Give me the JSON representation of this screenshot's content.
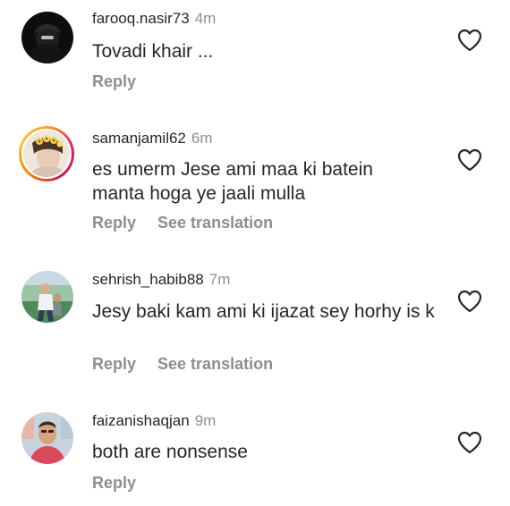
{
  "comments": [
    {
      "username": "farooq.nasir73",
      "time": "4m",
      "text": "Tovadi khair ...",
      "reply_label": "Reply",
      "like_icon": "heart-outline-icon"
    },
    {
      "username": "samanjamil62",
      "time": "6m",
      "text": "es umerm Jese ami maa ki batein manta hoga ye jaali mulla",
      "reply_label": "Reply",
      "translation_label": "See translation",
      "like_icon": "heart-outline-icon"
    },
    {
      "username": "sehrish_habib88",
      "time": "7m",
      "text": "Jesy baki kam ami ki ijazat sey horhy is k",
      "reply_label": "Reply",
      "translation_label": "See translation",
      "like_icon": "heart-outline-icon"
    },
    {
      "username": "faizanishaqjan",
      "time": "9m",
      "text": "both are nonsense",
      "reply_label": "Reply",
      "like_icon": "heart-outline-icon"
    }
  ],
  "colors": {
    "text": "#262626",
    "secondary": "#8e8e8e",
    "background": "#ffffff"
  }
}
